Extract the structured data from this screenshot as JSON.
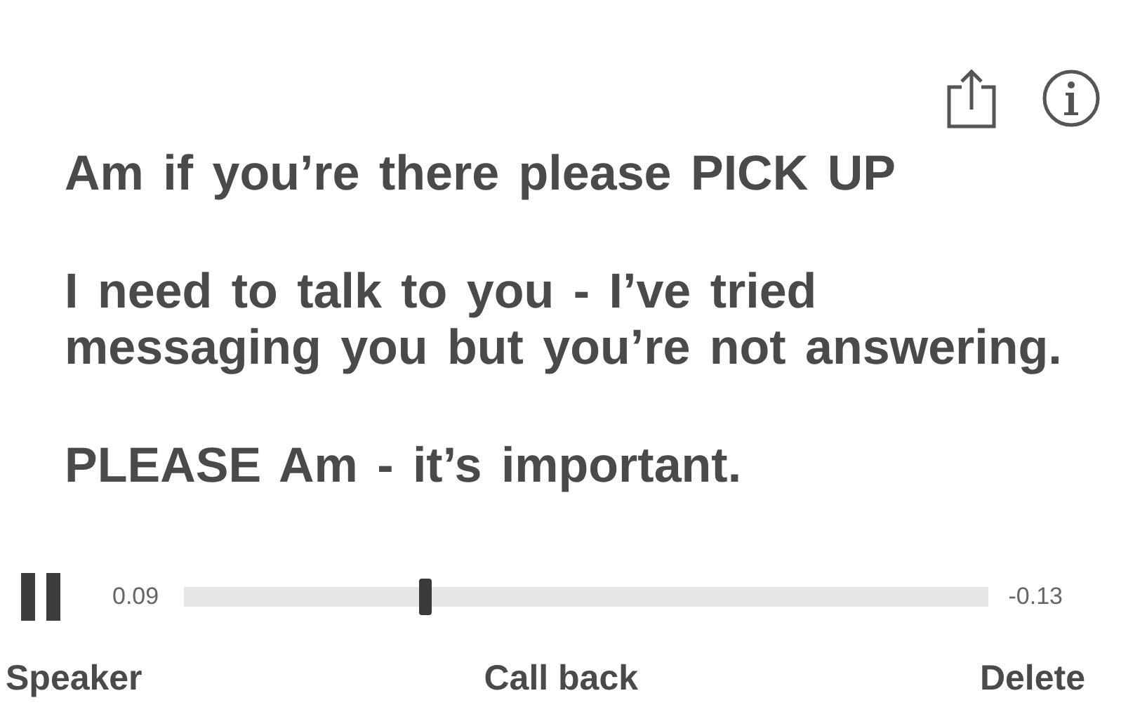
{
  "message": [
    "Am if you’re there please PICK UP",
    "I need to talk to you - I’ve tried messaging you but you’re not answering.",
    "PLEASE Am - it’s important."
  ],
  "player": {
    "playing": true,
    "elapsed": "0.09",
    "remaining": "-0.13",
    "level": 0.3
  },
  "actions": [
    {
      "label": "Speaker"
    },
    {
      "label": "Call back"
    },
    {
      "label": "Delete"
    }
  ]
}
